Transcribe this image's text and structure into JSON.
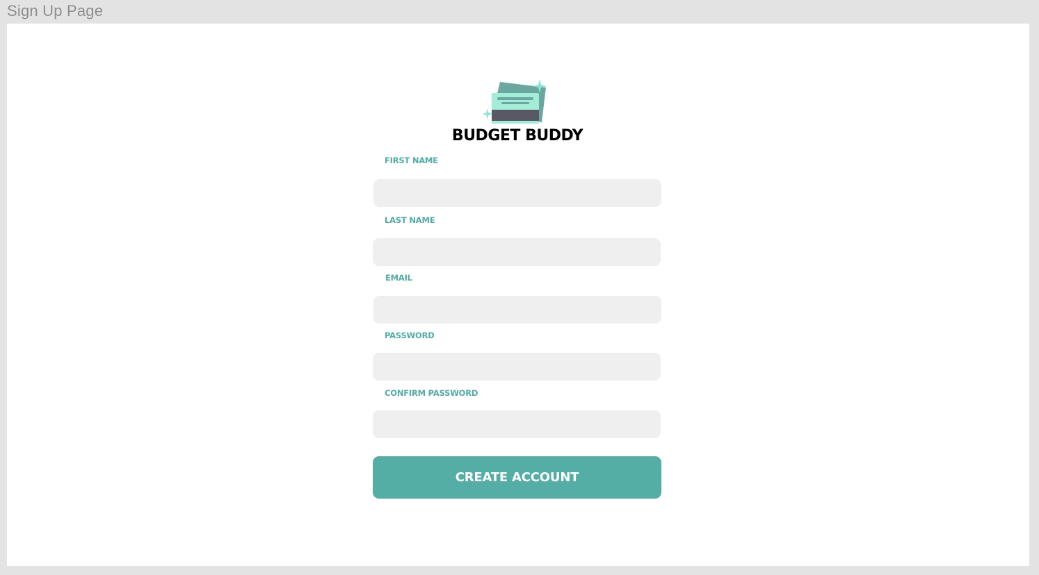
{
  "frame": {
    "title": "Sign Up Page"
  },
  "brand": {
    "name": "BUDGET BUDDY",
    "logo_icon": "wallet-cards-icon",
    "colors": {
      "accent": "#54aea6",
      "label": "#4fada6",
      "card_light": "#a3ecd7",
      "card_dark": "#6aa79e",
      "stripe": "#595966",
      "sparkle": "#8ae6d2"
    }
  },
  "form": {
    "fields": [
      {
        "label": "FIRST NAME",
        "value": "",
        "placeholder": ""
      },
      {
        "label": "LAST NAME",
        "value": "",
        "placeholder": ""
      },
      {
        "label": "EMAIL",
        "value": "",
        "placeholder": ""
      },
      {
        "label": "PASSWORD",
        "value": "",
        "placeholder": ""
      },
      {
        "label": "CONFIRM PASSWORD",
        "value": "",
        "placeholder": ""
      }
    ],
    "submit_label": "CREATE ACCOUNT"
  }
}
